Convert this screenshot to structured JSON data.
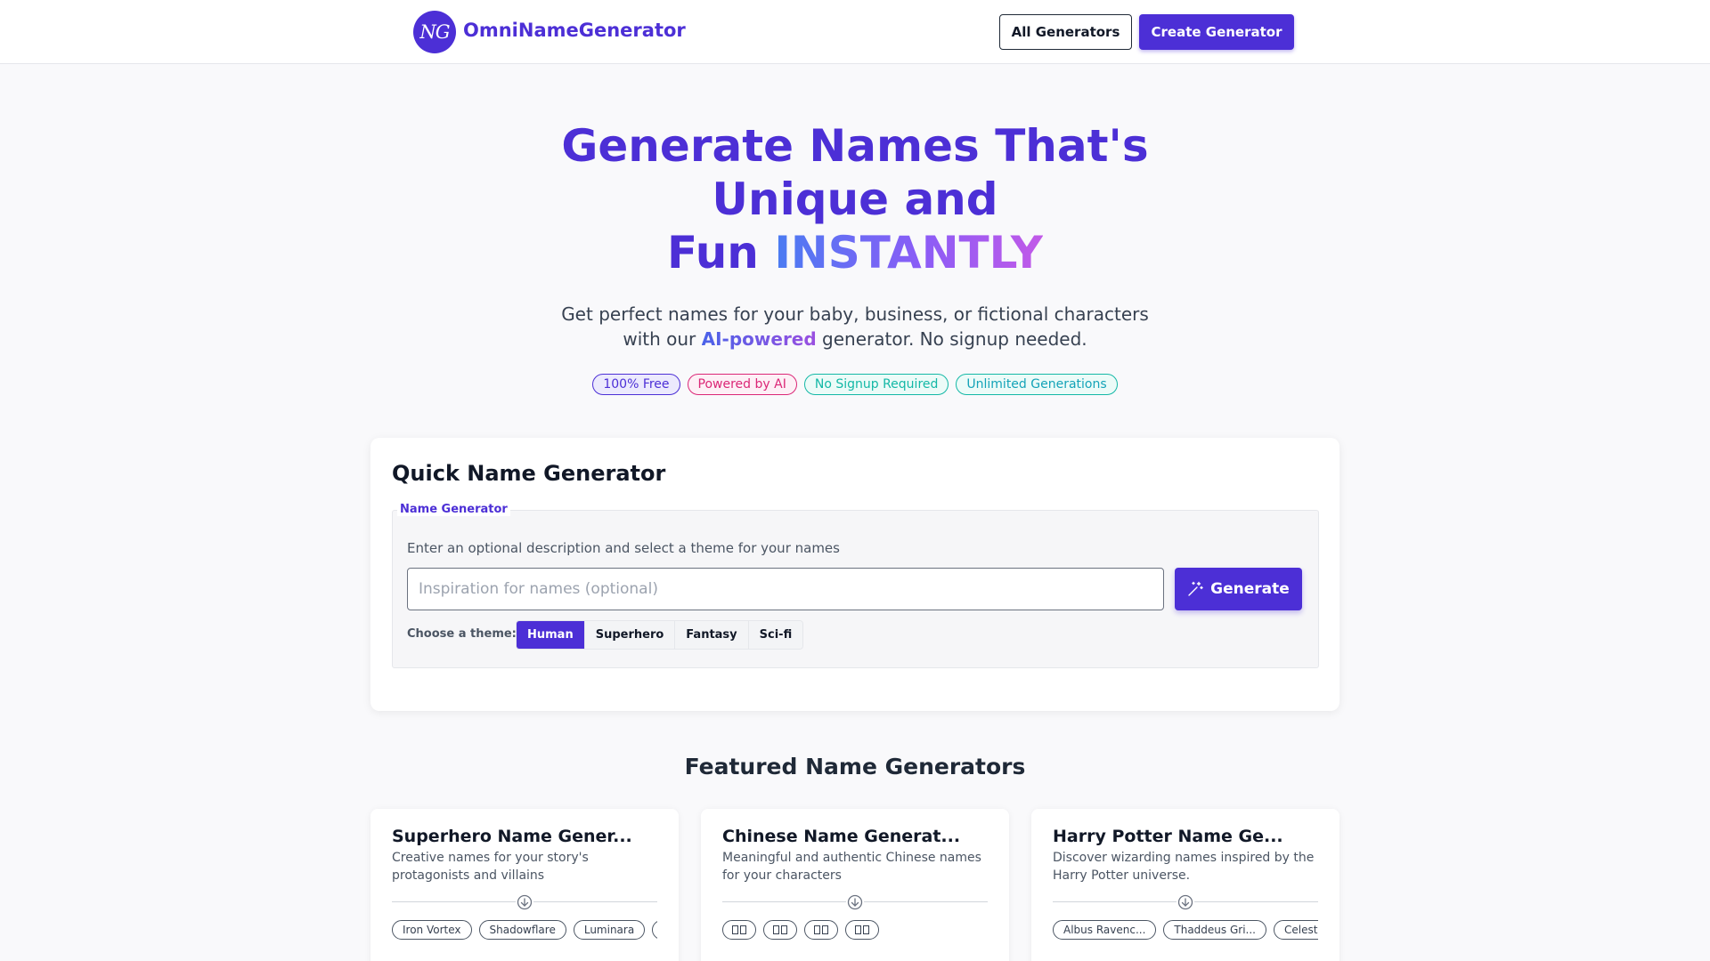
{
  "header": {
    "logo_text": "NG",
    "brand": "OmniNameGenerator",
    "all_generators": "All Generators",
    "create_generator": "Create Generator"
  },
  "hero": {
    "title_line1": "Generate Names That's",
    "title_line2": "Unique and",
    "title_line3_a": "Fun ",
    "title_line3_b": "INSTANTLY",
    "sub_line1": "Get perfect names for your baby, business, or fictional characters",
    "sub_line2_a": "with our ",
    "sub_line2_ai": "AI-powered",
    "sub_line2_b": " generator. No signup needed.",
    "badges": [
      "100% Free",
      "Powered by AI",
      "No Signup Required",
      "Unlimited Generations"
    ]
  },
  "quick": {
    "title": "Quick Name Generator",
    "legend": "Name Generator",
    "hint": "Enter an optional description and select a theme for your names",
    "placeholder": "Inspiration for names (optional)",
    "value": "",
    "generate": "Generate",
    "theme_label": "Choose a theme:",
    "themes": [
      "Human",
      "Superhero",
      "Fantasy",
      "Sci-fi"
    ],
    "selected_theme": "Human"
  },
  "featured": {
    "title": "Featured Name Generators",
    "cards": [
      {
        "title": "Superhero Name Gener...",
        "desc": "Creative names for your story's protagonists and villains",
        "chips": [
          "Iron Vortex",
          "Shadowflare",
          "Luminara",
          "C"
        ]
      },
      {
        "title": "Chinese Name Generat...",
        "desc": "Meaningful and authentic Chinese names for your characters",
        "chips": [
          "",
          "",
          "",
          ""
        ]
      },
      {
        "title": "Harry Potter Name Ge...",
        "desc": "Discover wizarding names inspired by the Harry Potter universe.",
        "chips": [
          "Albus Ravenc...",
          "Thaddeus Gri...",
          "Celestia"
        ]
      }
    ]
  },
  "colors": {
    "primary": "#4c2fd6",
    "pink": "#db2777",
    "teal": "#14b8a6"
  },
  "icons": {
    "generate": "magic-wand-icon",
    "divider": "arrow-down-circle-icon"
  }
}
